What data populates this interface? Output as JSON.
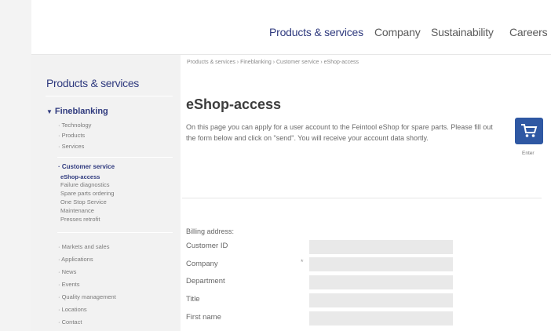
{
  "topnav": {
    "items": [
      "Products & services",
      "Company",
      "Sustainability",
      "Careers"
    ]
  },
  "sidebar": {
    "title": "Products & services",
    "section": "Fineblanking",
    "items": [
      "· Technology",
      "· Products",
      "· Services",
      "· Customer service",
      "eShop-access",
      "Failure diagnostics",
      "Spare parts ordering",
      "One Stop Service",
      "Maintenance",
      "Presses retrofit",
      "· Markets and sales",
      "· Applications",
      "· News",
      "· Events",
      "· Quality management",
      "· Locations",
      "· Contact"
    ]
  },
  "breadcrumb": "Products & services  ›  Fineblanking  ›  Customer service  ›  eShop-access",
  "main": {
    "heading": "eShop-access",
    "intro": "On this page you can apply for a user account to the Feintool eShop for spare parts. Please fill out the form below and click on \"send\". You will receive your account data shortly.",
    "cart_label": "Enter"
  },
  "form": {
    "section_label": "Billing address:",
    "required_mark": "*",
    "fields": [
      "Customer ID",
      "Company",
      "Department",
      "Title",
      "First name"
    ]
  }
}
